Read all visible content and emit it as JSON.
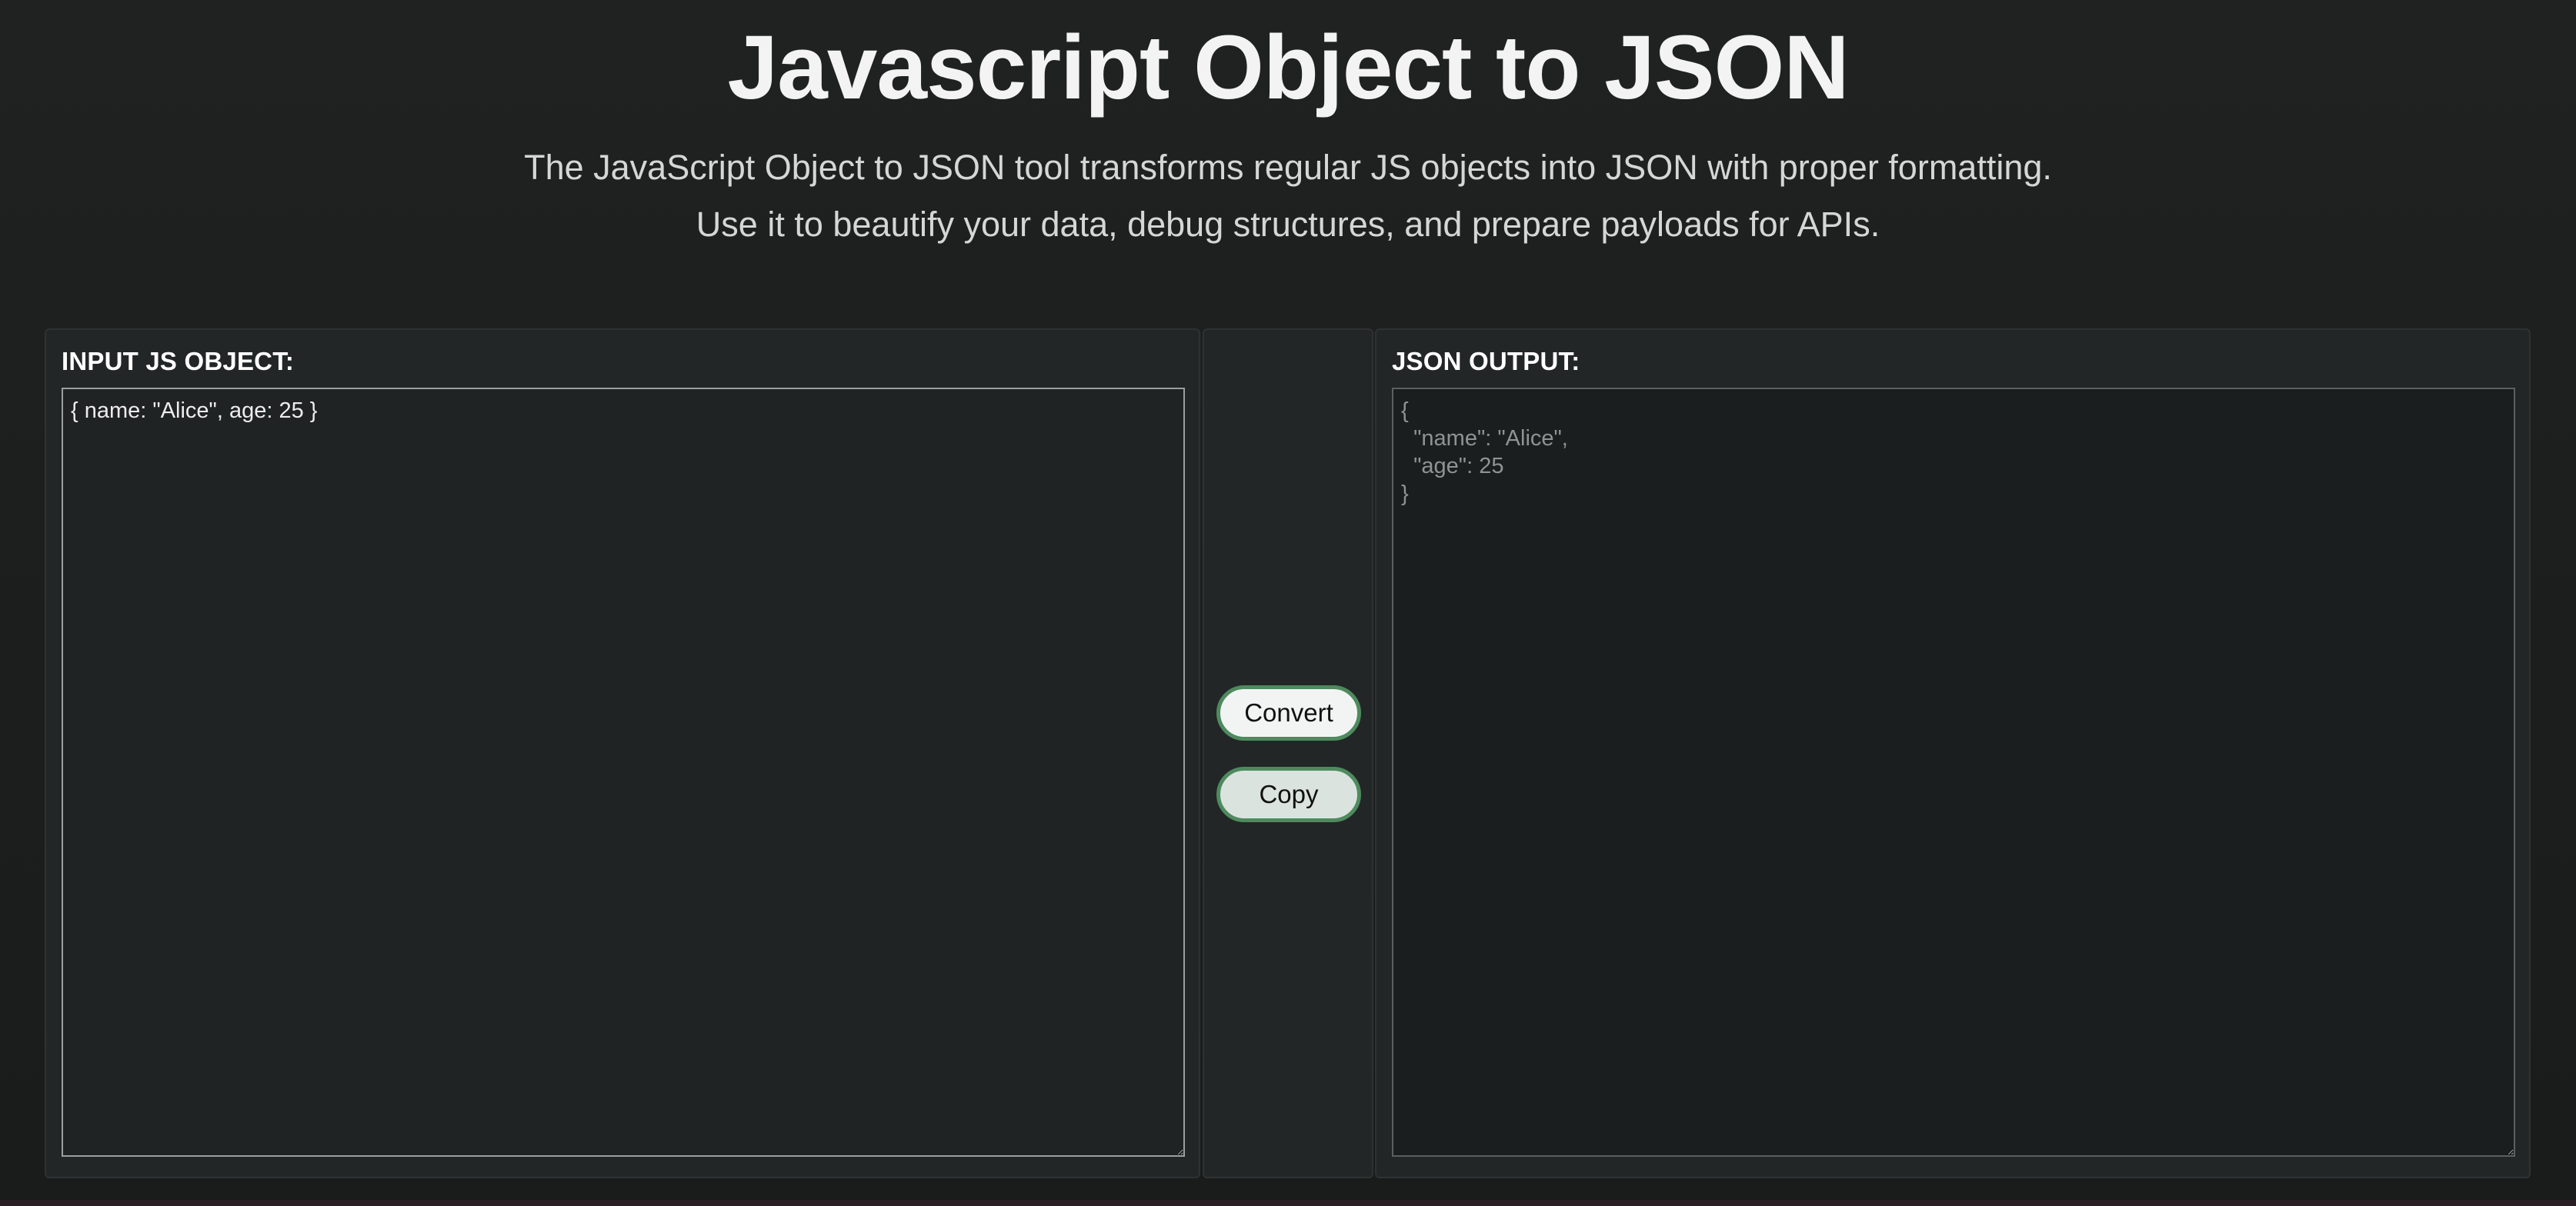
{
  "header": {
    "title": "Javascript Object to JSON",
    "subtitle_line1": "The JavaScript Object to JSON tool transforms regular JS objects into JSON with proper formatting.",
    "subtitle_line2": "Use it to beautify your data, debug structures, and prepare payloads for APIs."
  },
  "input_panel": {
    "label": "INPUT JS OBJECT:",
    "value": "{ name: \"Alice\", age: 25 }"
  },
  "actions": {
    "convert_label": "Convert",
    "copy_label": "Copy"
  },
  "output_panel": {
    "label": "JSON OUTPUT:",
    "value": "{\n  \"name\": \"Alice\",\n  \"age\": 25\n}"
  },
  "colors": {
    "background": "#1c1e1e",
    "panel": "#222626",
    "button_border": "#4e8a5e",
    "title_text": "#f3f3f3"
  }
}
